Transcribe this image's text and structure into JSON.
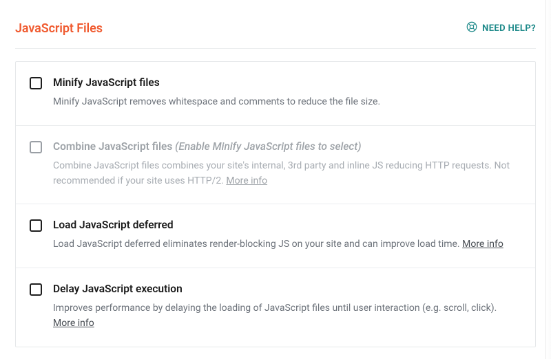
{
  "header": {
    "section_title": "JavaScript Files",
    "help_label": "NEED HELP?"
  },
  "more_info_label": "More info",
  "options": [
    {
      "id": "minify",
      "title": "Minify JavaScript files",
      "hint": "",
      "desc": "Minify JavaScript removes whitespace and comments to reduce the file size.",
      "disabled": false,
      "has_more": false,
      "checked": false
    },
    {
      "id": "combine",
      "title": "Combine JavaScript files",
      "hint": "(Enable Minify JavaScript files to select)",
      "desc": "Combine JavaScript files combines your site's internal, 3rd party and inline JS reducing HTTP requests. Not recommended if your site uses HTTP/2.",
      "disabled": true,
      "has_more": true,
      "checked": false
    },
    {
      "id": "defer",
      "title": "Load JavaScript deferred",
      "hint": "",
      "desc": "Load JavaScript deferred eliminates render-blocking JS on your site and can improve load time.",
      "disabled": false,
      "has_more": true,
      "checked": false
    },
    {
      "id": "delay",
      "title": "Delay JavaScript execution",
      "hint": "",
      "desc": "Improves performance by delaying the loading of JavaScript files until user interaction (e.g. scroll, click).",
      "disabled": false,
      "has_more": true,
      "checked": false
    }
  ]
}
